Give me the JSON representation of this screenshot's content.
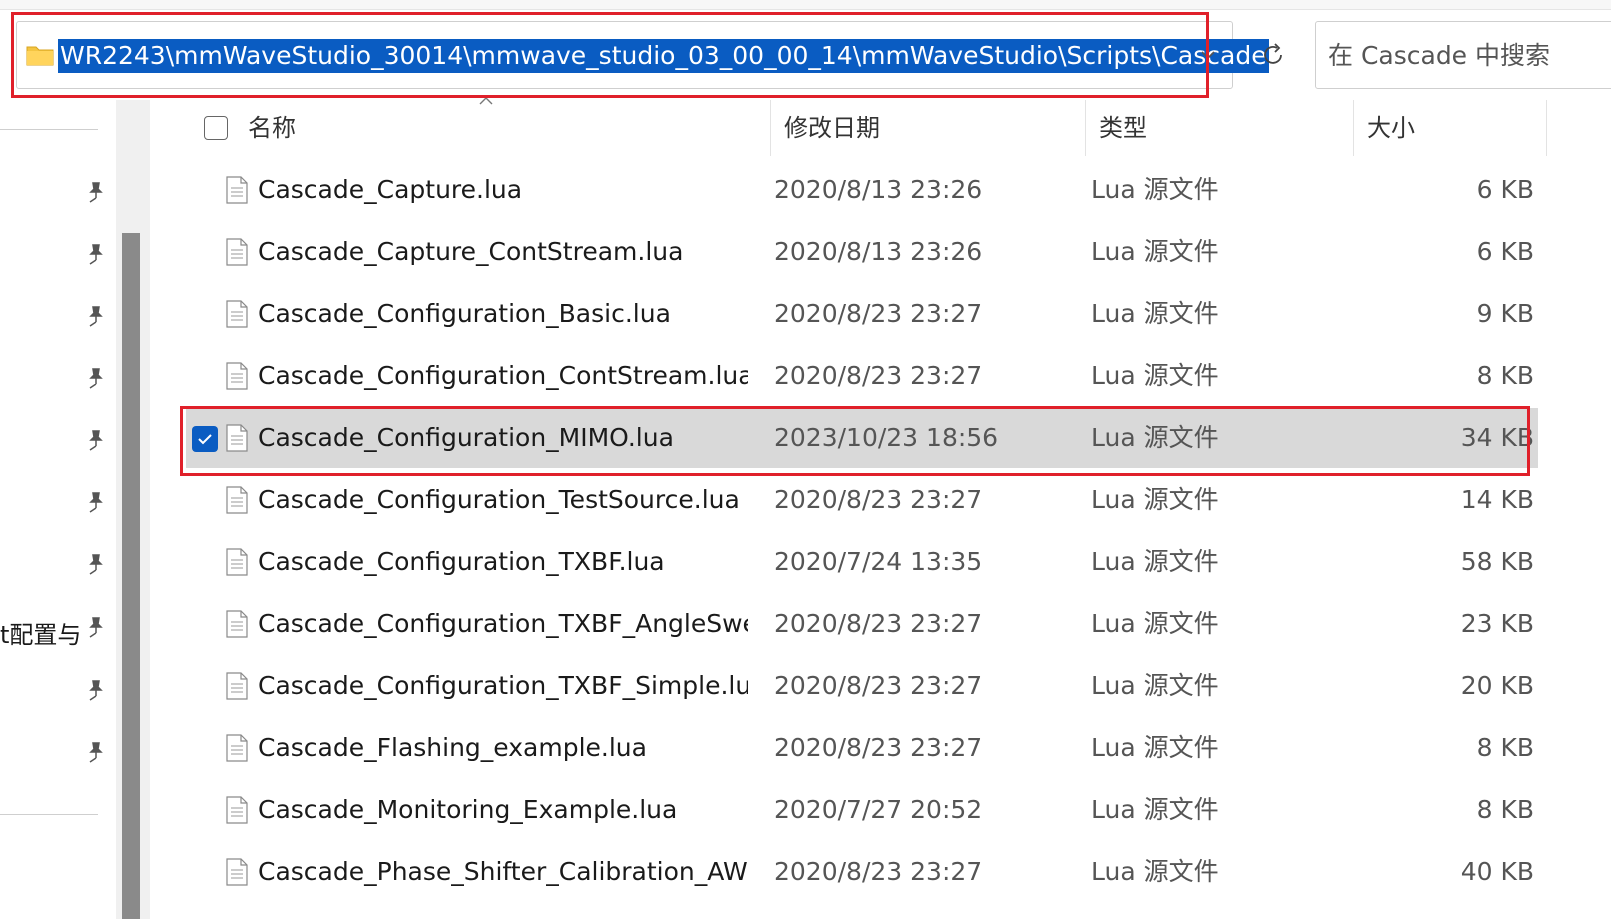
{
  "address_bar": {
    "path": "WR2243\\mmWaveStudio_30014\\mmwave_studio_03_00_00_14\\mmWaveStudio\\Scripts\\Cascade"
  },
  "search": {
    "placeholder": "在 Cascade 中搜索"
  },
  "nav_pane": {
    "truncated_label": "t配置与"
  },
  "columns": {
    "name": "名称",
    "modified": "修改日期",
    "type": "类型",
    "size": "大小"
  },
  "files": [
    {
      "name": "Cascade_Capture.lua",
      "modified": "2020/8/13 23:26",
      "type": "Lua 源文件",
      "size": "6 KB",
      "selected": false
    },
    {
      "name": "Cascade_Capture_ContStream.lua",
      "modified": "2020/8/13 23:26",
      "type": "Lua 源文件",
      "size": "6 KB",
      "selected": false
    },
    {
      "name": "Cascade_Configuration_Basic.lua",
      "modified": "2020/8/23 23:27",
      "type": "Lua 源文件",
      "size": "9 KB",
      "selected": false
    },
    {
      "name": "Cascade_Configuration_ContStream.lua",
      "modified": "2020/8/23 23:27",
      "type": "Lua 源文件",
      "size": "8 KB",
      "selected": false
    },
    {
      "name": "Cascade_Configuration_MIMO.lua",
      "modified": "2023/10/23 18:56",
      "type": "Lua 源文件",
      "size": "34 KB",
      "selected": true
    },
    {
      "name": "Cascade_Configuration_TestSource.lua",
      "modified": "2020/8/23 23:27",
      "type": "Lua 源文件",
      "size": "14 KB",
      "selected": false
    },
    {
      "name": "Cascade_Configuration_TXBF.lua",
      "modified": "2020/7/24 13:35",
      "type": "Lua 源文件",
      "size": "58 KB",
      "selected": false
    },
    {
      "name": "Cascade_Configuration_TXBF_AngleSwee...",
      "modified": "2020/8/23 23:27",
      "type": "Lua 源文件",
      "size": "23 KB",
      "selected": false
    },
    {
      "name": "Cascade_Configuration_TXBF_Simple.lua",
      "modified": "2020/8/23 23:27",
      "type": "Lua 源文件",
      "size": "20 KB",
      "selected": false
    },
    {
      "name": "Cascade_Flashing_example.lua",
      "modified": "2020/8/23 23:27",
      "type": "Lua 源文件",
      "size": "8 KB",
      "selected": false
    },
    {
      "name": "Cascade_Monitoring_Example.lua",
      "modified": "2020/7/27 20:52",
      "type": "Lua 源文件",
      "size": "8 KB",
      "selected": false
    },
    {
      "name": "Cascade_Phase_Shifter_Calibration_AWR...",
      "modified": "2020/8/23 23:27",
      "type": "Lua 源文件",
      "size": "40 KB",
      "selected": false
    }
  ],
  "colors": {
    "selection_blue": "#0a5cc2",
    "selected_row": "#d9d9d9",
    "highlight_red": "#e0202a"
  }
}
